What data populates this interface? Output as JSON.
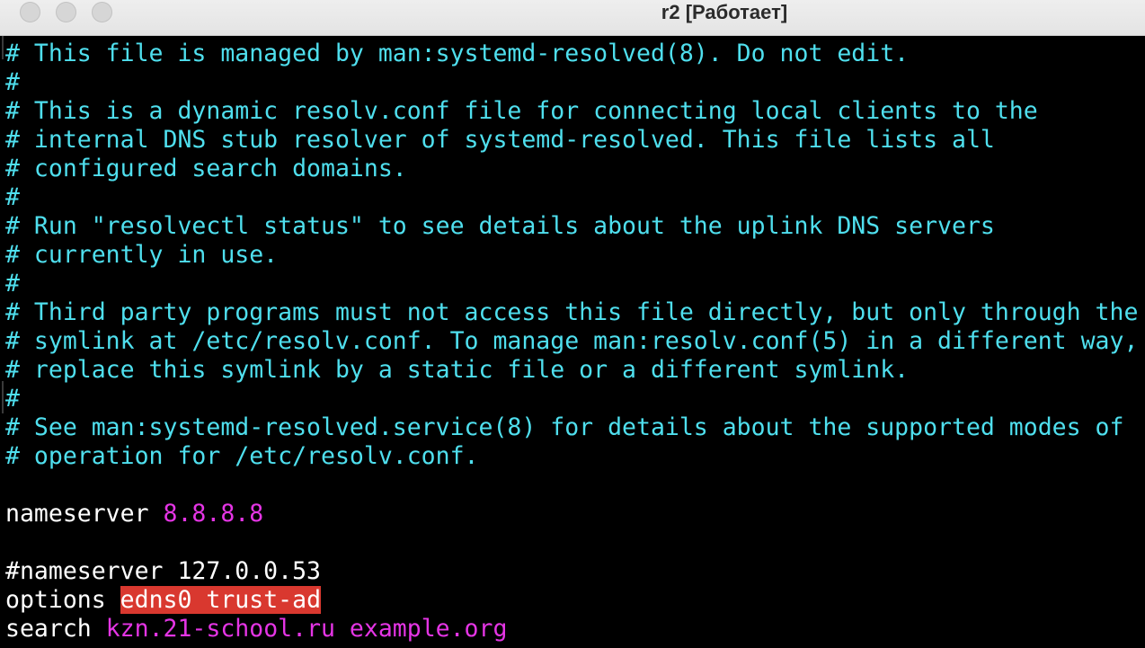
{
  "window": {
    "title": "r2 [Работает]"
  },
  "terminal": {
    "comment_lines": [
      "# This file is managed by man:systemd-resolved(8). Do not edit.",
      "#",
      "# This is a dynamic resolv.conf file for connecting local clients to the",
      "# internal DNS stub resolver of systemd-resolved. This file lists all",
      "# configured search domains.",
      "#",
      "# Run \"resolvectl status\" to see details about the uplink DNS servers",
      "# currently in use.",
      "#",
      "# Third party programs must not access this file directly, but only through the",
      "# symlink at /etc/resolv.conf. To manage man:resolv.conf(5) in a different way,",
      "# replace this symlink by a static file or a different symlink.",
      "#",
      "# See man:systemd-resolved.service(8) for details about the supported modes of",
      "# operation for /etc/resolv.conf."
    ],
    "nameserver": {
      "keyword": "nameserver",
      "value": "8.8.8.8"
    },
    "commented_nameserver": "#nameserver 127.0.0.53",
    "options": {
      "keyword": "options",
      "value": "edns0 trust-ad"
    },
    "search": {
      "keyword": "search",
      "value": "kzn.21-school.ru example.org"
    }
  },
  "colors": {
    "comment": "#4fdfee",
    "keyword": "#ffffff",
    "value": "#e535e5",
    "highlight_bg": "#d9382f",
    "background": "#000000"
  }
}
